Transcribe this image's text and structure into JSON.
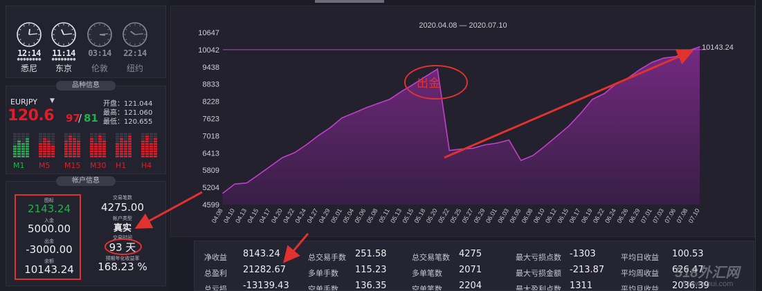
{
  "clocks": [
    {
      "time": "12:14",
      "city": "悉尼",
      "hour": 12,
      "minute": 14,
      "active": true
    },
    {
      "time": "11:14",
      "city": "东京",
      "hour": 11,
      "minute": 14,
      "active": true
    },
    {
      "time": "03:14",
      "city": "伦敦",
      "hour": 3,
      "minute": 14,
      "active": false
    },
    {
      "time": "22:14",
      "city": "纽约",
      "hour": 22,
      "minute": 14,
      "active": false
    }
  ],
  "symbol_section": {
    "tab_label": "品种信息",
    "name": "EURJPY",
    "price_main": "120.6",
    "price_bid_digits": "97",
    "price_ask_digits": "81",
    "open_label": "开盘：121.044",
    "high_label": "最高：121.060",
    "low_label": "最低：120.655",
    "timeframes": [
      "M1",
      "M5",
      "M15",
      "M30",
      "H1",
      "H4"
    ],
    "timeframe_colors": [
      "#1eb34a",
      "#e11c28",
      "#e11c28",
      "#e11c28",
      "#e11c28",
      "#e11c28"
    ]
  },
  "account": {
    "tab_label": "帐户信息",
    "net_label": "图标",
    "net_value": "2143.24",
    "deposit_label": "入金",
    "deposit_value": "5000.00",
    "withdraw_label": "出金",
    "withdraw_value": "-3000.00",
    "balance_label": "余额",
    "balance_value": "10143.24",
    "trades_label": "交易笔数",
    "trades_value": "4275.00",
    "type_label": "帐户类型",
    "type_value": "真实",
    "days_label": "交易时间",
    "days_value": "93 天",
    "annual_label": "预期年化收益率",
    "annual_value": "168.23 %"
  },
  "chart_data": {
    "type": "area",
    "title": "2020.04.08 — 2020.07.10",
    "x": [
      "04.08",
      "04.10",
      "04.13",
      "04.15",
      "04.17",
      "04.20",
      "04.22",
      "04.24",
      "04.27",
      "04.29",
      "05.01",
      "05.04",
      "05.06",
      "05.08",
      "05.11",
      "05.13",
      "05.15",
      "05.18",
      "05.20",
      "05.22",
      "05.25",
      "05.27",
      "05.29",
      "06.01",
      "06.03",
      "06.05",
      "06.08",
      "06.10",
      "06.12",
      "06.15",
      "06.17",
      "06.19",
      "06.22",
      "06.24",
      "06.26",
      "06.29",
      "07.01",
      "07.03",
      "07.06",
      "07.08",
      "07.10"
    ],
    "y_ticks": [
      4599,
      5204,
      5809,
      6413,
      7018,
      7623,
      8228,
      8833,
      9438,
      10042,
      10647
    ],
    "ylim": [
      4599,
      10647
    ],
    "reference_line": 10042,
    "last_value_label": "10143.24",
    "series": [
      {
        "values": [
          5000,
          5320,
          5360,
          5650,
          5950,
          6250,
          6420,
          6700,
          7020,
          7300,
          7650,
          7820,
          8000,
          8150,
          8300,
          8580,
          8830,
          9100,
          9360,
          6500,
          6550,
          6580,
          6700,
          6760,
          6870,
          6150,
          6320,
          6650,
          7000,
          7350,
          7800,
          8300,
          8500,
          8850,
          9050,
          9350,
          9600,
          9750,
          9800,
          10000,
          10143
        ]
      }
    ],
    "annotation_text": "出金",
    "color": "#c040c8"
  },
  "stats": [
    {
      "label": "净收益",
      "value": "8143.24"
    },
    {
      "label": "总盈利",
      "value": "21282.67"
    },
    {
      "label": "总亏损",
      "value": "-13139.43"
    },
    {
      "label": "总交易手数",
      "value": "251.58"
    },
    {
      "label": "多单手数",
      "value": "115.23"
    },
    {
      "label": "空单手数",
      "value": "136.35"
    },
    {
      "label": "总交易笔数",
      "value": "4275"
    },
    {
      "label": "多单笔数",
      "value": "2071"
    },
    {
      "label": "空单笔数",
      "value": "2204"
    },
    {
      "label": "最大亏损点数",
      "value": "-1303"
    },
    {
      "label": "最大亏损金额",
      "value": "-213.87"
    },
    {
      "label": "最大盈利点数",
      "value": "1311"
    },
    {
      "label": "平均日收益",
      "value": "100.53"
    },
    {
      "label": "平均周收益",
      "value": "626.47"
    },
    {
      "label": "平均月收益",
      "value": "2036.39"
    }
  ],
  "watermark": "518外汇网",
  "watermark_sub": "518waihui.com"
}
